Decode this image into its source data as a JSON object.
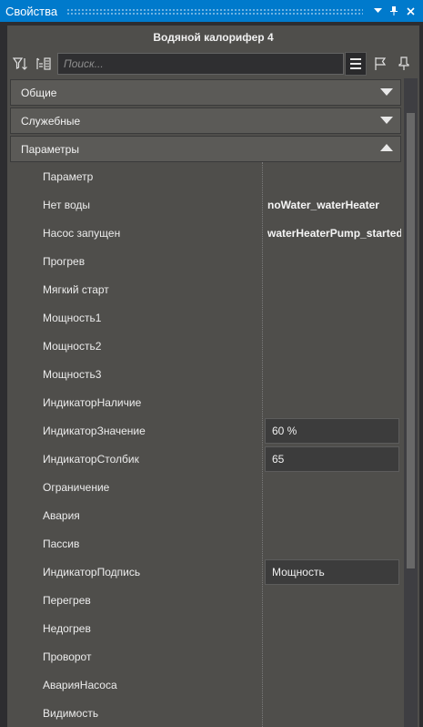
{
  "window": {
    "title": "Свойства"
  },
  "object_title": "Водяной калорифер 4",
  "search": {
    "placeholder": "Поиск..."
  },
  "sections": [
    {
      "label": "Общие",
      "expanded": false
    },
    {
      "label": "Служебные",
      "expanded": false
    },
    {
      "label": "Параметры",
      "expanded": true
    }
  ],
  "rows": [
    {
      "name": "Параметр",
      "value": ""
    },
    {
      "name": "Нет воды",
      "value": "noWater_waterHeater"
    },
    {
      "name": "Насос запущен",
      "value": "waterHeaterPump_started"
    },
    {
      "name": "Прогрев",
      "value": ""
    },
    {
      "name": "Мягкий старт",
      "value": ""
    },
    {
      "name": "Мощность1",
      "value": ""
    },
    {
      "name": "Мощность2",
      "value": ""
    },
    {
      "name": "Мощность3",
      "value": ""
    },
    {
      "name": "ИндикаторНаличие",
      "value": ""
    },
    {
      "name": "ИндикаторЗначение",
      "box": "60 %"
    },
    {
      "name": "ИндикаторСтолбик",
      "box": "65"
    },
    {
      "name": "Ограничение",
      "value": ""
    },
    {
      "name": "Авария",
      "value": ""
    },
    {
      "name": "Пассив",
      "value": ""
    },
    {
      "name": "ИндикаторПодпись",
      "box": "Мощность"
    },
    {
      "name": "Перегрев",
      "value": ""
    },
    {
      "name": "Недогрев",
      "value": ""
    },
    {
      "name": "Проворот",
      "value": ""
    },
    {
      "name": "АварияНасоса",
      "value": ""
    },
    {
      "name": "Видимость",
      "value": ""
    }
  ],
  "colors": {
    "titlebar": "#007acc",
    "panel": "#4f4e4b",
    "section": "#5b5a57"
  }
}
